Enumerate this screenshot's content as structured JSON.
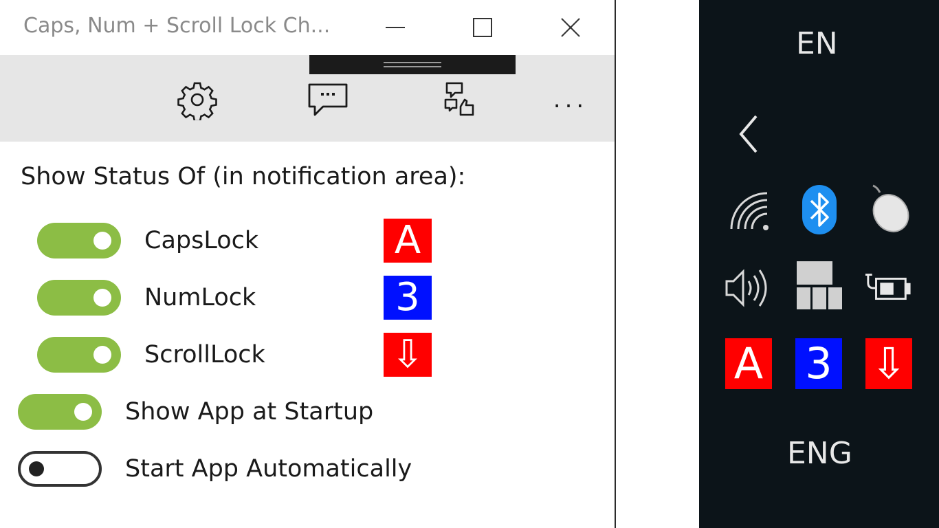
{
  "window": {
    "title": "Caps, Num + Scroll Lock Ch...",
    "minimize_icon": "minimize-icon",
    "maximize_icon": "maximize-icon",
    "close_icon": "close-icon"
  },
  "toolbar": {
    "settings_icon": "gear-icon",
    "feedback_icon": "chat-bubble-icon",
    "share_icon": "chat-thumbs-icon",
    "more_label": "..."
  },
  "settings": {
    "heading": "Show Status Of (in notification area):",
    "items": [
      {
        "label": "CapsLock",
        "enabled": true,
        "indicator": "A",
        "indicator_color": "#ff0000"
      },
      {
        "label": "NumLock",
        "enabled": true,
        "indicator": "3",
        "indicator_color": "#0010ff"
      },
      {
        "label": "ScrollLock",
        "enabled": true,
        "indicator": "⇩",
        "indicator_color": "#ff0000"
      }
    ],
    "show_app_at_startup": {
      "label": "Show App at Startup",
      "enabled": true
    },
    "start_app_automatically": {
      "label": "Start App Automatically",
      "enabled": false
    }
  },
  "tray": {
    "language_short": "EN",
    "language_long": "ENG",
    "collapse_icon": "chevron-left-icon",
    "icons": [
      "wifi-icon",
      "bluetooth-icon",
      "mouse-icon",
      "volume-icon",
      "tray-app-icon",
      "battery-charging-icon"
    ],
    "indicators": [
      {
        "text": "A",
        "color": "#ff0000"
      },
      {
        "text": "3",
        "color": "#0010ff"
      },
      {
        "text": "⇩",
        "color": "#ff0000"
      }
    ]
  },
  "colors": {
    "toggle_on": "#8cbd45",
    "toolbar_bg": "#e6e6e6",
    "tray_bg": "#0c1419"
  }
}
